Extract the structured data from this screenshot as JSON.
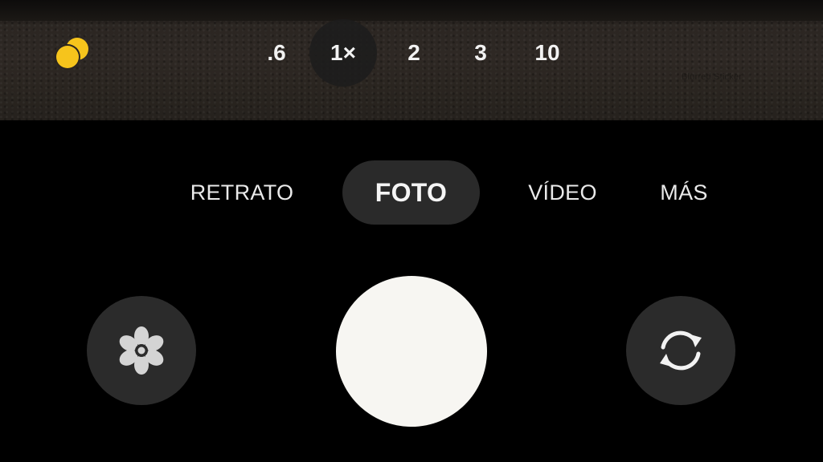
{
  "viewfinder": {
    "watermark_text": "Blurred Sticker"
  },
  "top_controls": {
    "flash_icon": "flash-auto-icon",
    "accent_color": "#f6c41c"
  },
  "zoom": {
    "levels": [
      ".6",
      "1×",
      "2",
      "3",
      "10"
    ],
    "selected": "1×"
  },
  "modes": {
    "items": [
      "RETRATO",
      "FOTO",
      "VÍDEO",
      "MÁS"
    ],
    "selected": "FOTO"
  },
  "bottom_controls": {
    "left_icon": "flower-macro-icon",
    "shutter_icon": "shutter-button",
    "right_icon": "switch-camera-icon"
  }
}
